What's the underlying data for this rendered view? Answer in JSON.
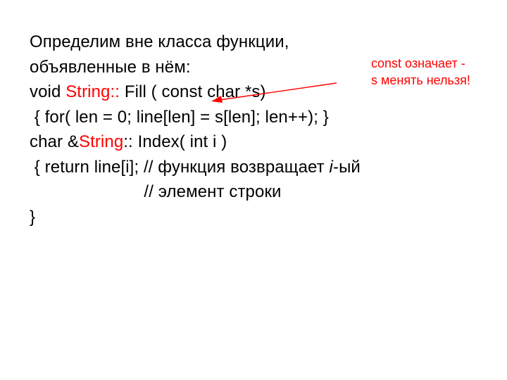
{
  "body": {
    "line1": "Определим вне класса функции,",
    "line2": "объявленные в нём:",
    "line3_a": "void ",
    "line3_b": "String::",
    "line3_c": " Fill ( const char *s)",
    "line4": " { for( len = 0; line[len] = s[len]; len++); }",
    "line5_a": "char &",
    "line5_b": "String",
    "line5_c": ":: Index( int i )",
    "line6_a": " { return line[i]; // функция возвращает ",
    "line6_i": "i",
    "line6_b": "-ый",
    "line7": "                        // элемент строки",
    "line8": "}"
  },
  "annotation": {
    "line1": "const  означает -",
    "line2": "s менять нельзя!"
  },
  "colors": {
    "arrow": "#ff0000"
  }
}
